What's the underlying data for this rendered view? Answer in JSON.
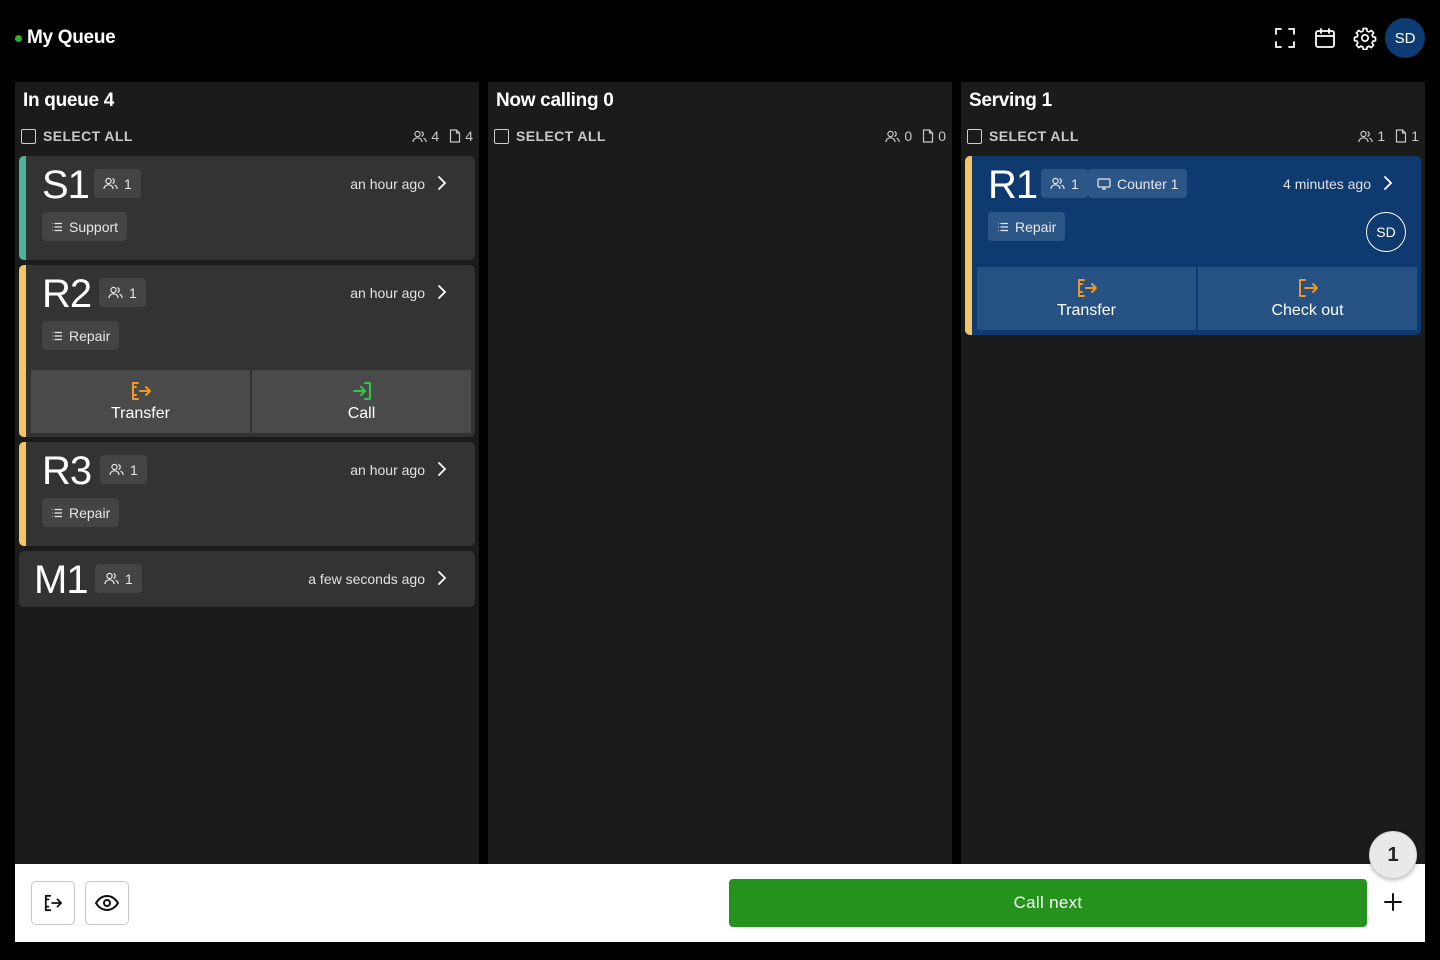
{
  "header": {
    "title": "My Queue",
    "status_color": "#2fb12f",
    "icons": [
      "fullscreen-icon",
      "calendar-icon",
      "settings-icon"
    ],
    "user_initials": "SD"
  },
  "columns": [
    {
      "title": "In queue 4",
      "select_all": "SELECT ALL",
      "people_count": "4",
      "doc_count": "4",
      "cards": [
        {
          "ticket": "S1",
          "party": "1",
          "time": "an hour ago",
          "service": "Support",
          "accent": "#4db39a"
        },
        {
          "ticket": "R2",
          "party": "1",
          "time": "an hour ago",
          "service": "Repair",
          "accent": "#f2c56b",
          "actions": {
            "transfer": "Transfer",
            "call": "Call"
          }
        },
        {
          "ticket": "R3",
          "party": "1",
          "time": "an hour ago",
          "service": "Repair",
          "accent": "#f2c56b"
        },
        {
          "ticket": "M1",
          "party": "1",
          "time": "a few seconds ago"
        }
      ]
    },
    {
      "title": "Now calling 0",
      "select_all": "SELECT ALL",
      "people_count": "0",
      "doc_count": "0"
    },
    {
      "title": "Serving 1",
      "select_all": "SELECT ALL",
      "people_count": "1",
      "doc_count": "1",
      "cards": [
        {
          "ticket": "R1",
          "party": "1",
          "counter": "Counter 1",
          "time": "4 minutes ago",
          "service": "Repair",
          "served_by": "SD",
          "accent": "#f2c56b",
          "actions": {
            "transfer": "Transfer",
            "checkout": "Check out"
          }
        }
      ]
    }
  ],
  "bottom": {
    "call_next": "Call next",
    "notification_count": "1",
    "call_next_color": "#26921e"
  }
}
